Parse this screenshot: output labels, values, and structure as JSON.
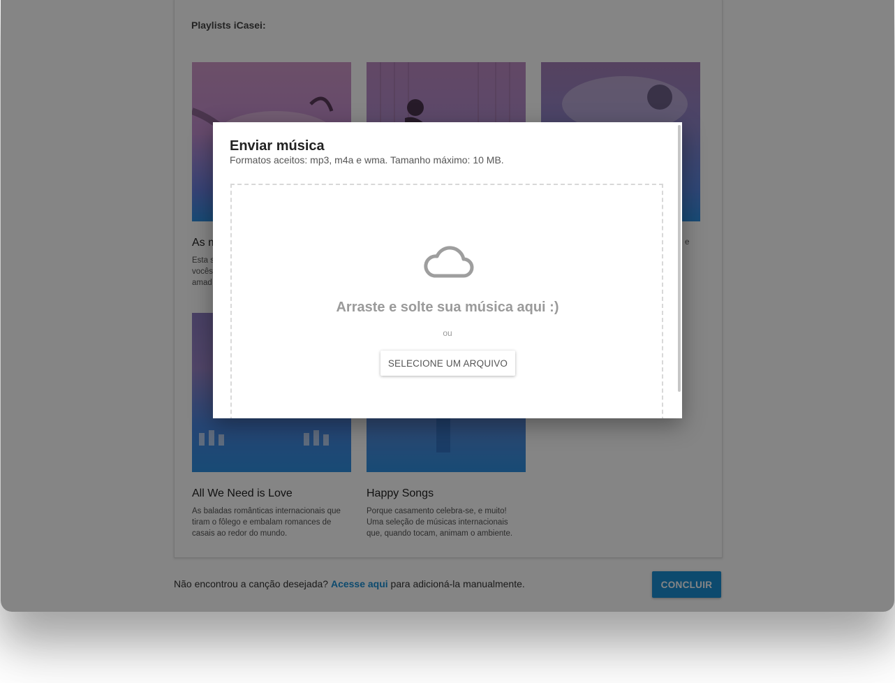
{
  "page": {
    "section_title": "Playlists iCasei:",
    "playlists": [
      {
        "name": "As m",
        "desc": "Esta s\nvocês\namad"
      },
      {
        "name": "",
        "desc": ""
      },
      {
        "name": "",
        "desc": "e"
      },
      {
        "name": "All We Need is Love",
        "desc": "As baladas românticas internacionais que tiram o fôlego e embalam romances de casais ao redor do mundo."
      },
      {
        "name": "Happy Songs",
        "desc": "Porque casamento celebra-se, e muito! Uma seleção de músicas internacionais que, quando tocam, animam o ambiente."
      }
    ]
  },
  "footer": {
    "text_before": "Não encontrou a canção desejada? ",
    "link": "Acesse aqui",
    "text_after": " para adicioná-la manualmente.",
    "button": "CONCLUIR"
  },
  "modal": {
    "title": "Enviar música",
    "subtitle": "Formatos aceitos: mp3, m4a e wma. Tamanho máximo: 10 MB.",
    "drop_text": "Arraste e solte sua música aqui :)",
    "or_text": "ou",
    "select_button": "SELECIONE UM ARQUIVO",
    "icon": "cloud-icon"
  },
  "colors": {
    "accent": "#1a8fd3",
    "thumb_top": "#c98fc0",
    "thumb_bottom": "#2e8fe0"
  }
}
